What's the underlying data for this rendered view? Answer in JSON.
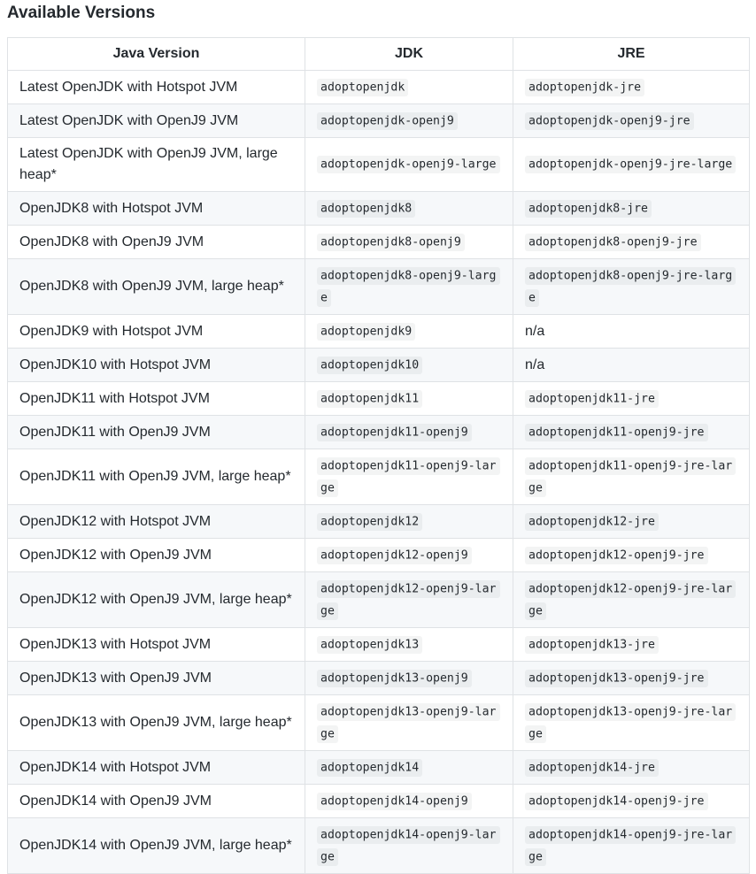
{
  "title": "Available Versions",
  "table": {
    "headers": [
      "Java Version",
      "JDK",
      "JRE"
    ],
    "rows": [
      {
        "version": "Latest OpenJDK with Hotspot JVM",
        "jdk": "adoptopenjdk",
        "jre": "adoptopenjdk-jre"
      },
      {
        "version": "Latest OpenJDK with OpenJ9 JVM",
        "jdk": "adoptopenjdk-openj9",
        "jre": "adoptopenjdk-openj9-jre"
      },
      {
        "version": "Latest OpenJDK with OpenJ9 JVM, large heap*",
        "jdk": "adoptopenjdk-openj9-large",
        "jre": "adoptopenjdk-openj9-jre-large"
      },
      {
        "version": "OpenJDK8 with Hotspot JVM",
        "jdk": "adoptopenjdk8",
        "jre": "adoptopenjdk8-jre"
      },
      {
        "version": "OpenJDK8 with OpenJ9 JVM",
        "jdk": "adoptopenjdk8-openj9",
        "jre": "adoptopenjdk8-openj9-jre"
      },
      {
        "version": "OpenJDK8 with OpenJ9 JVM, large heap*",
        "jdk": "adoptopenjdk8-openj9-large",
        "jre": "adoptopenjdk8-openj9-jre-large"
      },
      {
        "version": "OpenJDK9 with Hotspot JVM",
        "jdk": "adoptopenjdk9",
        "jre": "n/a"
      },
      {
        "version": "OpenJDK10 with Hotspot JVM",
        "jdk": "adoptopenjdk10",
        "jre": "n/a"
      },
      {
        "version": "OpenJDK11 with Hotspot JVM",
        "jdk": "adoptopenjdk11",
        "jre": "adoptopenjdk11-jre"
      },
      {
        "version": "OpenJDK11 with OpenJ9 JVM",
        "jdk": "adoptopenjdk11-openj9",
        "jre": "adoptopenjdk11-openj9-jre"
      },
      {
        "version": "OpenJDK11 with OpenJ9 JVM, large heap*",
        "jdk": "adoptopenjdk11-openj9-large",
        "jre": "adoptopenjdk11-openj9-jre-large"
      },
      {
        "version": "OpenJDK12 with Hotspot JVM",
        "jdk": "adoptopenjdk12",
        "jre": "adoptopenjdk12-jre"
      },
      {
        "version": "OpenJDK12 with OpenJ9 JVM",
        "jdk": "adoptopenjdk12-openj9",
        "jre": "adoptopenjdk12-openj9-jre"
      },
      {
        "version": "OpenJDK12 with OpenJ9 JVM, large heap*",
        "jdk": "adoptopenjdk12-openj9-large",
        "jre": "adoptopenjdk12-openj9-jre-large"
      },
      {
        "version": "OpenJDK13 with Hotspot JVM",
        "jdk": "adoptopenjdk13",
        "jre": "adoptopenjdk13-jre"
      },
      {
        "version": "OpenJDK13 with OpenJ9 JVM",
        "jdk": "adoptopenjdk13-openj9",
        "jre": "adoptopenjdk13-openj9-jre"
      },
      {
        "version": "OpenJDK13 with OpenJ9 JVM, large heap*",
        "jdk": "adoptopenjdk13-openj9-large",
        "jre": "adoptopenjdk13-openj9-jre-large"
      },
      {
        "version": "OpenJDK14 with Hotspot JVM",
        "jdk": "adoptopenjdk14",
        "jre": "adoptopenjdk14-jre"
      },
      {
        "version": "OpenJDK14 with OpenJ9 JVM",
        "jdk": "adoptopenjdk14-openj9",
        "jre": "adoptopenjdk14-openj9-jre"
      },
      {
        "version": "OpenJDK14 with OpenJ9 JVM, large heap*",
        "jdk": "adoptopenjdk14-openj9-large",
        "jre": "adoptopenjdk14-openj9-jre-large"
      }
    ]
  }
}
